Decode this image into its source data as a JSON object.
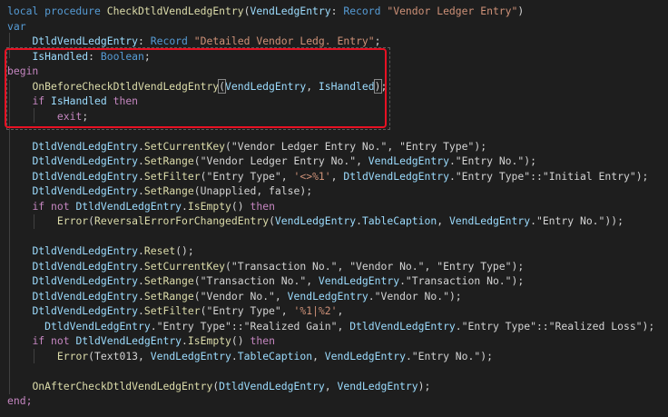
{
  "editor": {
    "lines": [
      {
        "tokens": [
          {
            "t": "local procedure ",
            "c": "kw"
          },
          {
            "t": "CheckDtldVendLedgEntry",
            "c": "fn"
          },
          {
            "t": "(",
            "c": "txt"
          },
          {
            "t": "VendLedgEntry",
            "c": "var"
          },
          {
            "t": ": ",
            "c": "txt"
          },
          {
            "t": "Record",
            "c": "kw"
          },
          {
            "t": " \"Vendor Ledger Entry\"",
            "c": "str"
          },
          {
            "t": ")",
            "c": "txt"
          }
        ]
      },
      {
        "tokens": [
          {
            "t": "var",
            "c": "kw"
          }
        ]
      },
      {
        "tokens": [
          {
            "t": "    ",
            "c": "txt"
          },
          {
            "t": "DtldVendLedgEntry",
            "c": "var"
          },
          {
            "t": ": ",
            "c": "txt"
          },
          {
            "t": "Record",
            "c": "kw"
          },
          {
            "t": " \"Detailed Vendor Ledg. Entry\"",
            "c": "str"
          },
          {
            "t": ";",
            "c": "txt"
          }
        ]
      },
      {
        "tokens": [
          {
            "t": "    ",
            "c": "txt"
          },
          {
            "t": "IsHandled",
            "c": "var"
          },
          {
            "t": ": ",
            "c": "txt"
          },
          {
            "t": "Boolean",
            "c": "kw"
          },
          {
            "t": ";",
            "c": "txt"
          }
        ]
      },
      {
        "tokens": [
          {
            "t": "begin",
            "c": "ctl"
          }
        ]
      },
      {
        "tokens": [
          {
            "t": "    ",
            "c": "txt"
          },
          {
            "t": "OnBeforeCheckDtldVendLedgEntry",
            "c": "fn"
          },
          {
            "t": "(",
            "c": "txt",
            "m": true
          },
          {
            "t": "VendLedgEntry",
            "c": "var"
          },
          {
            "t": ", ",
            "c": "txt"
          },
          {
            "t": "IsHandled",
            "c": "var"
          },
          {
            "t": ")",
            "c": "txt",
            "m": true
          },
          {
            "t": ";",
            "c": "txt"
          }
        ]
      },
      {
        "tokens": [
          {
            "t": "    ",
            "c": "txt"
          },
          {
            "t": "if ",
            "c": "ctl"
          },
          {
            "t": "IsHandled",
            "c": "var"
          },
          {
            "t": " then",
            "c": "ctl"
          }
        ]
      },
      {
        "tokens": [
          {
            "t": "        ",
            "c": "txt"
          },
          {
            "t": "exit",
            "c": "ctl"
          },
          {
            "t": ";",
            "c": "txt"
          }
        ]
      },
      {
        "tokens": []
      },
      {
        "tokens": [
          {
            "t": "    ",
            "c": "txt"
          },
          {
            "t": "DtldVendLedgEntry",
            "c": "var"
          },
          {
            "t": ".",
            "c": "txt"
          },
          {
            "t": "SetCurrentKey",
            "c": "fn"
          },
          {
            "t": "(\"Vendor Ledger Entry No.\", \"Entry Type\");",
            "c": "txt"
          }
        ]
      },
      {
        "tokens": [
          {
            "t": "    ",
            "c": "txt"
          },
          {
            "t": "DtldVendLedgEntry",
            "c": "var"
          },
          {
            "t": ".",
            "c": "txt"
          },
          {
            "t": "SetRange",
            "c": "fn"
          },
          {
            "t": "(\"Vendor Ledger Entry No.\", ",
            "c": "txt"
          },
          {
            "t": "VendLedgEntry",
            "c": "var"
          },
          {
            "t": ".\"Entry No.\");",
            "c": "txt"
          }
        ]
      },
      {
        "tokens": [
          {
            "t": "    ",
            "c": "txt"
          },
          {
            "t": "DtldVendLedgEntry",
            "c": "var"
          },
          {
            "t": ".",
            "c": "txt"
          },
          {
            "t": "SetFilter",
            "c": "fn"
          },
          {
            "t": "(\"Entry Type\", ",
            "c": "txt"
          },
          {
            "t": "'<>%1'",
            "c": "str"
          },
          {
            "t": ", ",
            "c": "txt"
          },
          {
            "t": "DtldVendLedgEntry",
            "c": "var"
          },
          {
            "t": ".\"Entry Type\"::\"Initial Entry\");",
            "c": "txt"
          }
        ]
      },
      {
        "tokens": [
          {
            "t": "    ",
            "c": "txt"
          },
          {
            "t": "DtldVendLedgEntry",
            "c": "var"
          },
          {
            "t": ".",
            "c": "txt"
          },
          {
            "t": "SetRange",
            "c": "fn"
          },
          {
            "t": "(Unapplied, false);",
            "c": "txt"
          }
        ]
      },
      {
        "tokens": [
          {
            "t": "    ",
            "c": "txt"
          },
          {
            "t": "if not ",
            "c": "ctl"
          },
          {
            "t": "DtldVendLedgEntry",
            "c": "var"
          },
          {
            "t": ".",
            "c": "txt"
          },
          {
            "t": "IsEmpty",
            "c": "fn"
          },
          {
            "t": "()",
            "c": "txt"
          },
          {
            "t": " then",
            "c": "ctl"
          }
        ]
      },
      {
        "tokens": [
          {
            "t": "        ",
            "c": "txt"
          },
          {
            "t": "Error",
            "c": "fn"
          },
          {
            "t": "(",
            "c": "txt"
          },
          {
            "t": "ReversalErrorForChangedEntry",
            "c": "fn"
          },
          {
            "t": "(",
            "c": "txt"
          },
          {
            "t": "VendLedgEntry",
            "c": "var"
          },
          {
            "t": ".",
            "c": "txt"
          },
          {
            "t": "TableCaption",
            "c": "var"
          },
          {
            "t": ", ",
            "c": "txt"
          },
          {
            "t": "VendLedgEntry",
            "c": "var"
          },
          {
            "t": ".\"Entry No.\"));",
            "c": "txt"
          }
        ]
      },
      {
        "tokens": []
      },
      {
        "tokens": [
          {
            "t": "    ",
            "c": "txt"
          },
          {
            "t": "DtldVendLedgEntry",
            "c": "var"
          },
          {
            "t": ".",
            "c": "txt"
          },
          {
            "t": "Reset",
            "c": "fn"
          },
          {
            "t": "();",
            "c": "txt"
          }
        ]
      },
      {
        "tokens": [
          {
            "t": "    ",
            "c": "txt"
          },
          {
            "t": "DtldVendLedgEntry",
            "c": "var"
          },
          {
            "t": ".",
            "c": "txt"
          },
          {
            "t": "SetCurrentKey",
            "c": "fn"
          },
          {
            "t": "(\"Transaction No.\", \"Vendor No.\", \"Entry Type\");",
            "c": "txt"
          }
        ]
      },
      {
        "tokens": [
          {
            "t": "    ",
            "c": "txt"
          },
          {
            "t": "DtldVendLedgEntry",
            "c": "var"
          },
          {
            "t": ".",
            "c": "txt"
          },
          {
            "t": "SetRange",
            "c": "fn"
          },
          {
            "t": "(\"Transaction No.\", ",
            "c": "txt"
          },
          {
            "t": "VendLedgEntry",
            "c": "var"
          },
          {
            "t": ".\"Transaction No.\");",
            "c": "txt"
          }
        ]
      },
      {
        "tokens": [
          {
            "t": "    ",
            "c": "txt"
          },
          {
            "t": "DtldVendLedgEntry",
            "c": "var"
          },
          {
            "t": ".",
            "c": "txt"
          },
          {
            "t": "SetRange",
            "c": "fn"
          },
          {
            "t": "(\"Vendor No.\", ",
            "c": "txt"
          },
          {
            "t": "VendLedgEntry",
            "c": "var"
          },
          {
            "t": ".\"Vendor No.\");",
            "c": "txt"
          }
        ]
      },
      {
        "tokens": [
          {
            "t": "    ",
            "c": "txt"
          },
          {
            "t": "DtldVendLedgEntry",
            "c": "var"
          },
          {
            "t": ".",
            "c": "txt"
          },
          {
            "t": "SetFilter",
            "c": "fn"
          },
          {
            "t": "(\"Entry Type\", ",
            "c": "txt"
          },
          {
            "t": "'%1|%2'",
            "c": "str"
          },
          {
            "t": ",",
            "c": "txt"
          }
        ]
      },
      {
        "tokens": [
          {
            "t": "      ",
            "c": "txt"
          },
          {
            "t": "DtldVendLedgEntry",
            "c": "var"
          },
          {
            "t": ".\"Entry Type\"::\"Realized Gain\", ",
            "c": "txt"
          },
          {
            "t": "DtldVendLedgEntry",
            "c": "var"
          },
          {
            "t": ".\"Entry Type\"::\"Realized Loss\");",
            "c": "txt"
          }
        ]
      },
      {
        "tokens": [
          {
            "t": "    ",
            "c": "txt"
          },
          {
            "t": "if not ",
            "c": "ctl"
          },
          {
            "t": "DtldVendLedgEntry",
            "c": "var"
          },
          {
            "t": ".",
            "c": "txt"
          },
          {
            "t": "IsEmpty",
            "c": "fn"
          },
          {
            "t": "()",
            "c": "txt"
          },
          {
            "t": " then",
            "c": "ctl"
          }
        ]
      },
      {
        "tokens": [
          {
            "t": "        ",
            "c": "txt"
          },
          {
            "t": "Error",
            "c": "fn"
          },
          {
            "t": "(Text013, ",
            "c": "txt"
          },
          {
            "t": "VendLedgEntry",
            "c": "var"
          },
          {
            "t": ".",
            "c": "txt"
          },
          {
            "t": "TableCaption",
            "c": "var"
          },
          {
            "t": ", ",
            "c": "txt"
          },
          {
            "t": "VendLedgEntry",
            "c": "var"
          },
          {
            "t": ".\"Entry No.\");",
            "c": "txt"
          }
        ]
      },
      {
        "tokens": []
      },
      {
        "tokens": [
          {
            "t": "    ",
            "c": "txt"
          },
          {
            "t": "OnAfterCheckDtldVendLedgEntry",
            "c": "fn"
          },
          {
            "t": "(",
            "c": "txt"
          },
          {
            "t": "DtldVendLedgEntry",
            "c": "var"
          },
          {
            "t": ", ",
            "c": "txt"
          },
          {
            "t": "VendLedgEntry",
            "c": "var"
          },
          {
            "t": ");",
            "c": "txt"
          }
        ]
      },
      {
        "tokens": [
          {
            "t": "end;",
            "c": "ctl"
          }
        ]
      }
    ]
  },
  "colors": {
    "background": "#1e1e1e",
    "keyword": "#569cd6",
    "control": "#c586c0",
    "string": "#ce9178",
    "function": "#dcdcaa",
    "variable": "#9cdcfe",
    "text": "#d4d4d4",
    "highlight_border": "#e81123"
  }
}
